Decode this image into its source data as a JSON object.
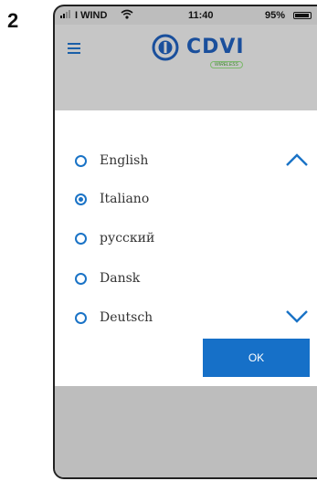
{
  "step_number": "2",
  "status_bar": {
    "carrier": "I WIND",
    "time": "11:40",
    "battery_percent": "95%"
  },
  "header": {
    "logo_text": "CDVI",
    "logo_subtext": "WIRELESS",
    "menu_icon": "hamburger-icon"
  },
  "language_dialog": {
    "options": [
      {
        "label": "English",
        "selected": false
      },
      {
        "label": "Italiano",
        "selected": true
      },
      {
        "label": "русский",
        "selected": false
      },
      {
        "label": "Dansk",
        "selected": false
      },
      {
        "label": "Deutsch",
        "selected": false
      }
    ],
    "scroll_up_icon": "chevron-up-icon",
    "scroll_down_icon": "chevron-down-icon",
    "ok_label": "OK"
  },
  "colors": {
    "accent": "#1a73c6",
    "button": "#1670c8",
    "overlay": "#bdbdbd"
  }
}
